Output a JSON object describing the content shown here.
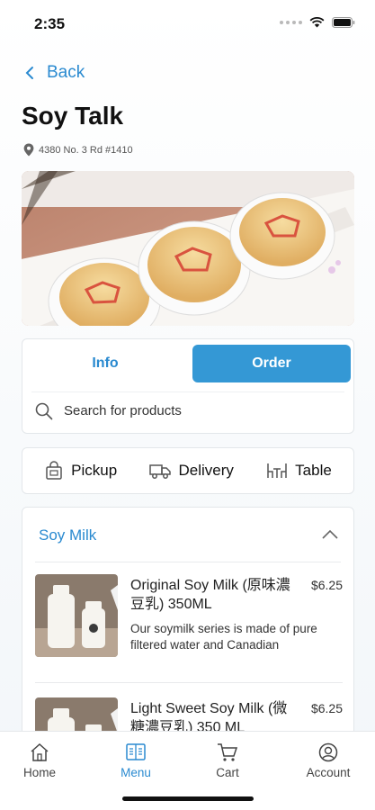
{
  "status": {
    "time": "2:35"
  },
  "header": {
    "back_label": "Back",
    "title": "Soy Talk",
    "address": "4380 No. 3 Rd #1410"
  },
  "tabs": {
    "info": "Info",
    "order": "Order",
    "active": "Order"
  },
  "search": {
    "placeholder": "Search for products"
  },
  "modes": {
    "pickup": "Pickup",
    "delivery": "Delivery",
    "table": "Table"
  },
  "section": {
    "title": "Soy Milk",
    "products": [
      {
        "name": "Original Soy Milk (原味濃豆乳) 350ML",
        "price": "$6.25",
        "description": "Our soymilk series is made of pure filtered water and Canadian"
      },
      {
        "name": "Light Sweet Soy Milk (微糖濃豆乳) 350 ML",
        "price": "$6.25",
        "description": ""
      }
    ]
  },
  "nav": {
    "home": "Home",
    "menu": "Menu",
    "cart": "Cart",
    "account": "Account",
    "active": "Menu"
  },
  "colors": {
    "accent": "#2a8ad0",
    "primary_button": "#3498d5"
  }
}
